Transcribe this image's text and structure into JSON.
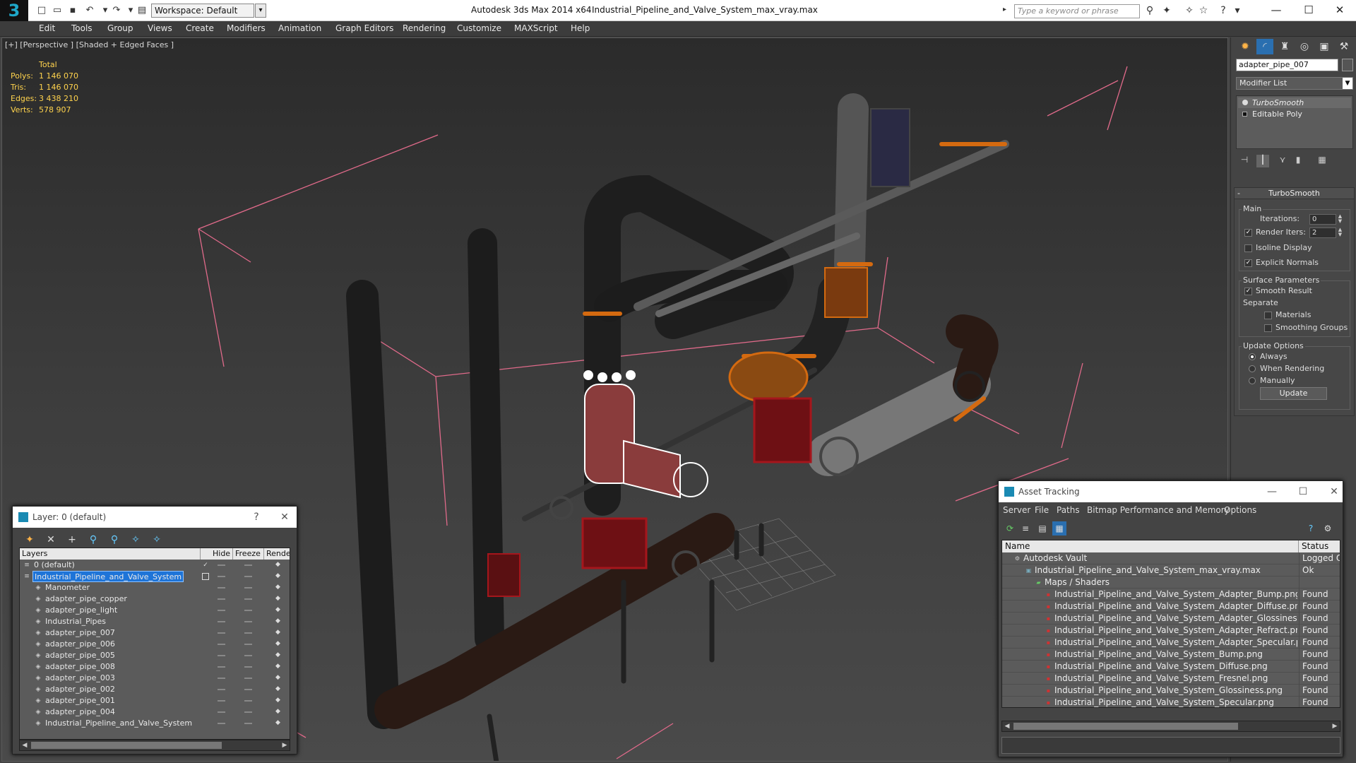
{
  "titlebar": {
    "workspace": "Workspace: Default",
    "app_name": "Autodesk 3ds Max  2014 x64",
    "file_name": "Industrial_Pipeline_and_Valve_System_max_vray.max",
    "search_placeholder": "Type a keyword or phrase"
  },
  "menu": [
    "Edit",
    "Tools",
    "Group",
    "Views",
    "Create",
    "Modifiers",
    "Animation",
    "Graph Editors",
    "Rendering",
    "Customize",
    "MAXScript",
    "Help"
  ],
  "viewport": {
    "label": "[+] [Perspective ] [Shaded + Edged Faces ]",
    "stats": {
      "header": "Total",
      "rows": [
        {
          "label": "Polys:",
          "value": "1 146 070"
        },
        {
          "label": "Tris:",
          "value": "1 146 070"
        },
        {
          "label": "Edges:",
          "value": "3 438 210"
        },
        {
          "label": "Verts:",
          "value": "578 907"
        }
      ]
    }
  },
  "command_panel": {
    "object_name": "adapter_pipe_007",
    "modifier_list": "Modifier List",
    "stack": [
      "TurboSmooth",
      "Editable Poly"
    ],
    "rollout_title": "TurboSmooth",
    "main_label": "Main",
    "iterations_label": "Iterations:",
    "iterations_value": "0",
    "render_iters_label": "Render Iters:",
    "render_iters_value": "2",
    "isoline": "Isoline Display",
    "explicit_normals": "Explicit Normals",
    "surface_params": "Surface Parameters",
    "smooth_result": "Smooth Result",
    "separate": "Separate",
    "materials": "Materials",
    "smoothing_groups": "Smoothing Groups",
    "update_options": "Update Options",
    "always": "Always",
    "when_rendering": "When Rendering",
    "manually": "Manually",
    "update_button": "Update"
  },
  "layer_dialog": {
    "title": "Layer: 0 (default)",
    "help": "?",
    "columns": [
      "Layers",
      "Hide",
      "Freeze",
      "Rende"
    ],
    "rows": [
      "0 (default)",
      "Industrial_Pipeline_and_Valve_System",
      "Manometer",
      "adapter_pipe_copper",
      "adapter_pipe_light",
      "Industrial_Pipes",
      "adapter_pipe_007",
      "adapter_pipe_006",
      "adapter_pipe_005",
      "adapter_pipe_008",
      "adapter_pipe_003",
      "adapter_pipe_002",
      "adapter_pipe_001",
      "adapter_pipe_004",
      "Industrial_Pipeline_and_Valve_System"
    ]
  },
  "asset_dialog": {
    "title": "Asset Tracking",
    "menu": [
      "Server",
      "File",
      "Paths",
      "Bitmap Performance and Memory",
      "Options"
    ],
    "columns": [
      "Name",
      "Status"
    ],
    "rows": [
      {
        "name": "Autodesk Vault",
        "status": "Logged Out"
      },
      {
        "name": "Industrial_Pipeline_and_Valve_System_max_vray.max",
        "status": "Ok"
      },
      {
        "name": "Maps / Shaders",
        "status": ""
      },
      {
        "name": "Industrial_Pipeline_and_Valve_System_Adapter_Bump.png",
        "status": "Found"
      },
      {
        "name": "Industrial_Pipeline_and_Valve_System_Adapter_Diffuse.png",
        "status": "Found"
      },
      {
        "name": "Industrial_Pipeline_and_Valve_System_Adapter_Glossiness.png",
        "status": "Found"
      },
      {
        "name": "Industrial_Pipeline_and_Valve_System_Adapter_Refract.png",
        "status": "Found"
      },
      {
        "name": "Industrial_Pipeline_and_Valve_System_Adapter_Specular.png",
        "status": "Found"
      },
      {
        "name": "Industrial_Pipeline_and_Valve_System_Bump.png",
        "status": "Found"
      },
      {
        "name": "Industrial_Pipeline_and_Valve_System_Diffuse.png",
        "status": "Found"
      },
      {
        "name": "Industrial_Pipeline_and_Valve_System_Fresnel.png",
        "status": "Found"
      },
      {
        "name": "Industrial_Pipeline_and_Valve_System_Glossiness.png",
        "status": "Found"
      },
      {
        "name": "Industrial_Pipeline_and_Valve_System_Specular.png",
        "status": "Found"
      }
    ]
  },
  "colors": {
    "stats_text": "#ffd34d",
    "selection": "#1e74d8",
    "bounding_box": "#e06a8a",
    "pipe_orange": "#d46a10",
    "pipe_red": "#a5161c"
  },
  "icons": {
    "logo": "3ds-max-logo-icon",
    "new": "new-file-icon",
    "open": "open-file-icon",
    "save": "save-icon",
    "undo": "undo-icon",
    "redo": "redo-icon",
    "help": "help-icon"
  }
}
